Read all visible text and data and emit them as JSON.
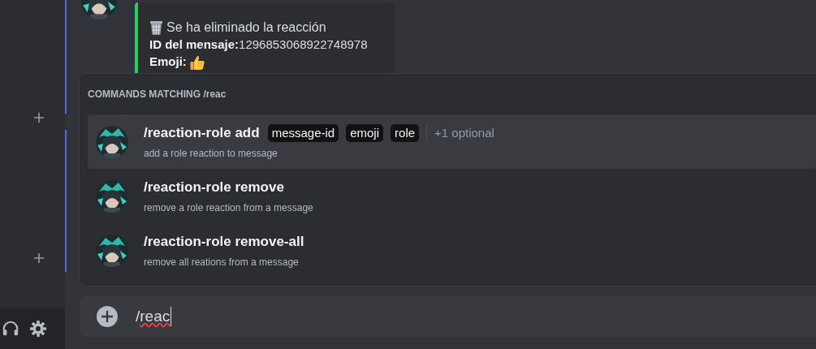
{
  "message": {
    "embed": {
      "title": "Se ha eliminado la reacción",
      "lines": [
        {
          "text": "**ID del mensaje:**1296853068922748978"
        },
        {
          "text": "**Emoji:** ",
          "kind": "emoji"
        }
      ]
    }
  },
  "autocomplete": {
    "header": "COMMANDS MATCHING /reac",
    "commands": [
      {
        "name": "/reaction-role add",
        "options": [
          "message-id",
          "emoji",
          "role"
        ],
        "optional": "+1 optional",
        "description": "add a role reaction to message",
        "selected": true
      },
      {
        "name": "/reaction-role remove",
        "description": "remove a role reaction from a message",
        "selected": false
      },
      {
        "name": "/reaction-role remove-all",
        "description": "remove all reations from a message",
        "selected": false
      }
    ]
  },
  "composer": {
    "value": "/reac"
  }
}
